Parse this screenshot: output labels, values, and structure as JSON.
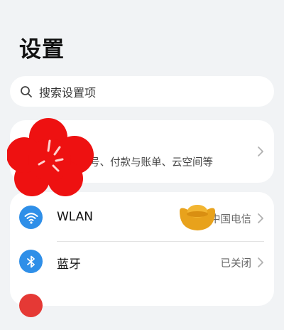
{
  "header": {
    "title": "设置"
  },
  "search": {
    "placeholder": "搜索设置项",
    "icon": "search-icon"
  },
  "account_card": {
    "description": "号、付款与账单、云空间等"
  },
  "settings": [
    {
      "label": "WLAN",
      "value": "中国电信",
      "icon": "wifi-icon"
    },
    {
      "label": "蓝牙",
      "value": "已关闭",
      "icon": "bluetooth-icon"
    }
  ],
  "colors": {
    "background": "#f1f3f5",
    "card": "#ffffff",
    "icon_blue": "#2f8fe8",
    "blossom_red": "#ee1111",
    "ingot_gold": "#e8a21c"
  }
}
